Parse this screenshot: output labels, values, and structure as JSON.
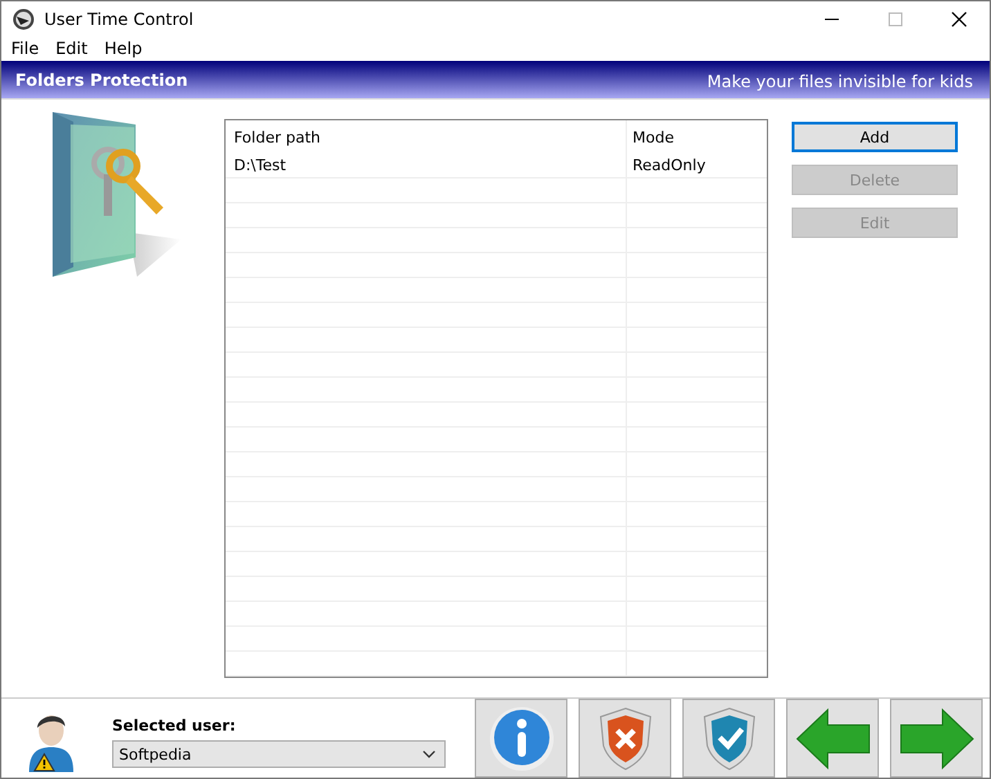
{
  "window": {
    "title": "User Time Control"
  },
  "menu": [
    "File",
    "Edit",
    "Help"
  ],
  "banner": {
    "title": "Folders Protection",
    "subtitle": "Make your files invisible for kids"
  },
  "table": {
    "columns": [
      "Folder path",
      "Mode"
    ],
    "rows": [
      [
        "D:\\Test",
        "ReadOnly"
      ]
    ]
  },
  "buttons": [
    {
      "label": "Add",
      "disabled": false,
      "focused": true
    },
    {
      "label": "Delete",
      "disabled": true,
      "focused": false
    },
    {
      "label": "Edit",
      "disabled": true,
      "focused": false
    }
  ],
  "user": {
    "label": "Selected user:",
    "value": "Softpedia"
  },
  "toolbar": [
    {
      "kind": "info"
    },
    {
      "kind": "deny"
    },
    {
      "kind": "allow"
    },
    {
      "kind": "back"
    },
    {
      "kind": "forward"
    }
  ]
}
